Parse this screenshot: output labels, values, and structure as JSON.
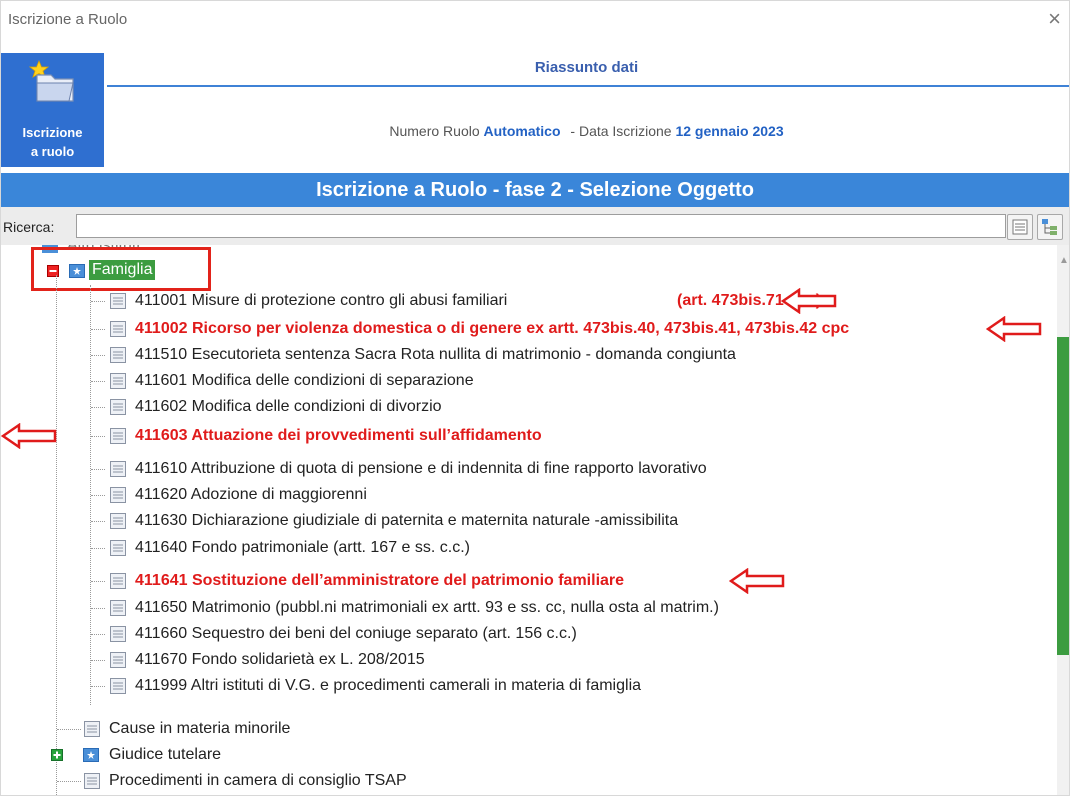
{
  "window": {
    "title": "Iscrizione a Ruolo",
    "close_glyph": "×"
  },
  "sidebar": {
    "label_line1": "Iscrizione",
    "label_line2": "a ruolo",
    "icon": "folder-star-icon"
  },
  "summary": {
    "title": "Riassunto dati",
    "numero_label": "Numero Ruolo",
    "numero_value": "Automatico",
    "data_label": "- Data Iscrizione",
    "data_value": "12 gennaio 2023"
  },
  "banner": {
    "title": "Iscrizione a Ruolo - fase 2 - Selezione Oggetto"
  },
  "search": {
    "label": "Ricerca:",
    "value": "",
    "placeholder": ""
  },
  "tree": {
    "partial_top": "Altri istituti",
    "famiglia": "Famiglia",
    "items": [
      {
        "text": "411001 Misure di protezione contro gli abusi familiari",
        "note": "(art. 473bis.71 cpc)",
        "highlight": false,
        "annotated": true
      },
      {
        "text": "411002 Ricorso per violenza domestica o di genere ex artt. 473bis.40, 473bis.41, 473bis.42 cpc",
        "note": "",
        "highlight": true,
        "annotated": true
      },
      {
        "text": "411510 Esecutorieta sentenza Sacra Rota nullita di matrimonio - domanda congiunta",
        "note": "",
        "highlight": false,
        "annotated": false
      },
      {
        "text": "411601 Modifica delle condizioni di separazione",
        "note": "",
        "highlight": false,
        "annotated": false
      },
      {
        "text": "411602 Modifica delle condizioni di divorzio",
        "note": "",
        "highlight": false,
        "annotated": false
      },
      {
        "text": "411603 Attuazione dei provvedimenti sull’affidamento",
        "note": "",
        "highlight": true,
        "annotated": true
      },
      {
        "text": "411610 Attribuzione di quota di pensione e di indennita di fine rapporto lavorativo",
        "note": "",
        "highlight": false,
        "annotated": false
      },
      {
        "text": "411620 Adozione di maggiorenni",
        "note": "",
        "highlight": false,
        "annotated": false
      },
      {
        "text": "411630 Dichiarazione giudiziale di paternita e maternita naturale -amissibilita",
        "note": "",
        "highlight": false,
        "annotated": false
      },
      {
        "text": "411640 Fondo patrimoniale (artt. 167 e ss. c.c.)",
        "note": "",
        "highlight": false,
        "annotated": false
      },
      {
        "text": "411641 Sostituzione dell’amministratore del patrimonio familiare",
        "note": "",
        "highlight": true,
        "annotated": true
      },
      {
        "text": "411650 Matrimonio (pubbl.ni matrimoniali ex artt. 93 e ss. cc, nulla osta al matrim.)",
        "note": "",
        "highlight": false,
        "annotated": false
      },
      {
        "text": "411660 Sequestro dei beni del coniuge separato (art. 156 c.c.)",
        "note": "",
        "highlight": false,
        "annotated": false
      },
      {
        "text": "411670 Fondo solidarietà ex L. 208/2015",
        "note": "",
        "highlight": false,
        "annotated": false
      },
      {
        "text": "411999 Altri istituti di V.G. e procedimenti camerali  in materia di famiglia",
        "note": "",
        "highlight": false,
        "annotated": false
      }
    ],
    "siblings": [
      {
        "text": "Cause in materia minorile",
        "type": "leaf"
      },
      {
        "text": "Giudice tutelare",
        "type": "folder-collapsed"
      },
      {
        "text": "Procedimenti in camera di consiglio TSAP",
        "type": "leaf"
      }
    ]
  },
  "colors": {
    "accent_blue": "#3a86d9",
    "highlight_red": "#e01b1b",
    "selection_green": "#3c9c40",
    "scroll_green": "#3c9c40"
  }
}
